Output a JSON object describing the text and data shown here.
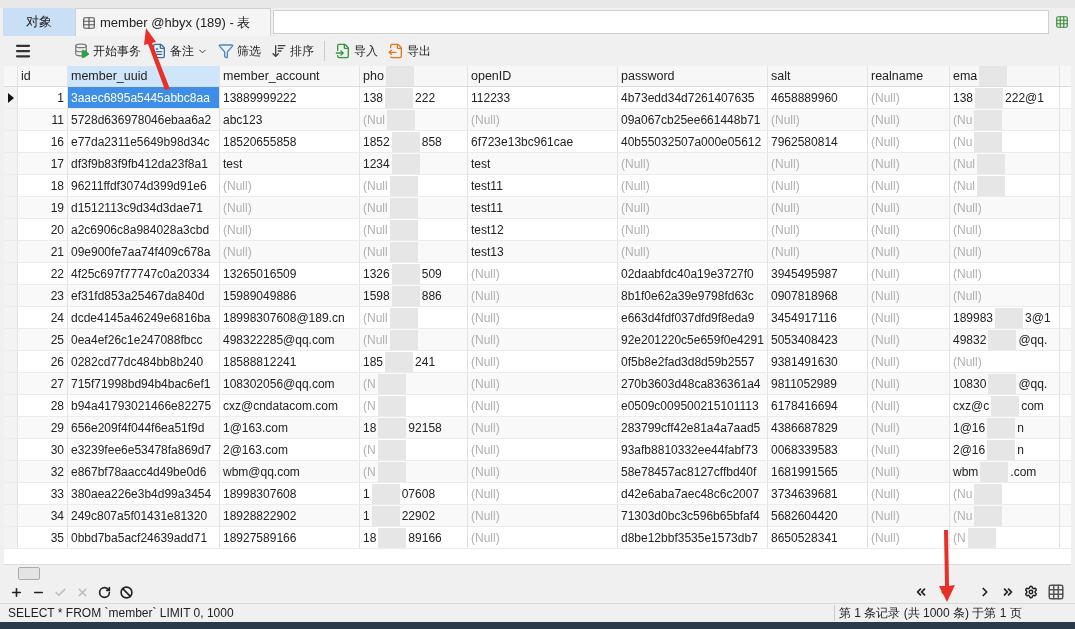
{
  "tabs": [
    {
      "label": "对象",
      "selected": false,
      "kind": "plain"
    },
    {
      "label": "member @hbyx (189) - 表",
      "selected": true,
      "kind": "table"
    }
  ],
  "toolbar": [
    {
      "kind": "begin",
      "label": "开始事务"
    },
    {
      "kind": "note",
      "label": "备注"
    },
    {
      "kind": "filter",
      "label": "筛选"
    },
    {
      "kind": "sort",
      "label": "排序"
    },
    {
      "kind": "import",
      "label": "导入"
    },
    {
      "kind": "export",
      "label": "导出"
    }
  ],
  "table": {
    "columns": [
      {
        "label": "id",
        "focused": false
      },
      {
        "label": "member_uuid",
        "focused": true
      },
      {
        "label": "member_account",
        "focused": false
      },
      {
        "label": "pho",
        "focused": false,
        "redacted": true
      },
      {
        "label": "openID",
        "focused": false
      },
      {
        "label": "password",
        "focused": false
      },
      {
        "label": "salt",
        "focused": false
      },
      {
        "label": "realname",
        "focused": false
      },
      {
        "label": "ema",
        "focused": false,
        "redacted": true
      }
    ],
    "rows": [
      {
        "selected": true,
        "cells": [
          "1",
          "3aaec6895a5445abbc8aa",
          "13889999222",
          {
            "t": "138",
            "t2": "222",
            "redacted": true
          },
          "112233",
          "4b73edd34d7261407635",
          "4658889960",
          {
            "t": "(Null)",
            "null": true
          },
          {
            "t": "138",
            "t2": "222@1",
            "redacted": true
          }
        ]
      },
      {
        "selected": false,
        "cells": [
          "11",
          "5728d636978046ebaa6a2",
          "abc123",
          {
            "t": "(Nul",
            "null": true,
            "redacted": true
          },
          {
            "t": "(Null)",
            "null": true
          },
          "09a067cb25ee661448b71",
          {
            "t": "(Null)",
            "null": true
          },
          {
            "t": "(Null)",
            "null": true
          },
          {
            "t": "(Nu",
            "null": true,
            "redacted": true
          }
        ]
      },
      {
        "selected": false,
        "cells": [
          "16",
          "e77da2311e5649b98d34c",
          "18520655858",
          {
            "t": "1852",
            "t2": "858",
            "redacted": true
          },
          "6f723e13bc961cae",
          "40b55032507a000e05612",
          "7962580814",
          {
            "t": "(Null)",
            "null": true
          },
          {
            "t": "(Nu",
            "null": true,
            "redacted": true
          }
        ]
      },
      {
        "selected": false,
        "cells": [
          "17",
          "df3f9b83f9fb412da23f8a1",
          "test",
          {
            "t": "1234",
            "redacted": true
          },
          "test",
          {
            "t": "(Null)",
            "null": true
          },
          {
            "t": "(Null)",
            "null": true
          },
          {
            "t": "(Null)",
            "null": true
          },
          {
            "t": "(Nul",
            "null": true,
            "redacted": true
          }
        ]
      },
      {
        "selected": false,
        "cells": [
          "18",
          "96211ffdf3074d399d91e6",
          {
            "t": "(Null)",
            "null": true
          },
          {
            "t": "(Null",
            "null": true,
            "redacted": true
          },
          "test11",
          {
            "t": "(Null)",
            "null": true
          },
          {
            "t": "(Null)",
            "null": true
          },
          {
            "t": "(Null)",
            "null": true
          },
          {
            "t": "(Nul",
            "null": true,
            "redacted": true
          }
        ]
      },
      {
        "selected": false,
        "cells": [
          "19",
          "d1512113c9d34d3dae71",
          {
            "t": "(Null)",
            "null": true
          },
          {
            "t": "(Null",
            "null": true,
            "redacted": true
          },
          "test11",
          {
            "t": "(Null)",
            "null": true
          },
          {
            "t": "(Null)",
            "null": true
          },
          {
            "t": "(Null)",
            "null": true
          },
          {
            "t": "(Null)",
            "null": true
          }
        ]
      },
      {
        "selected": false,
        "cells": [
          "20",
          "a2c6906c8a984028a3cbd",
          {
            "t": "(Null)",
            "null": true
          },
          {
            "t": "(Null",
            "null": true,
            "redacted": true
          },
          "test12",
          {
            "t": "(Null)",
            "null": true
          },
          {
            "t": "(Null)",
            "null": true
          },
          {
            "t": "(Null)",
            "null": true
          },
          {
            "t": "(Null)",
            "null": true
          }
        ]
      },
      {
        "selected": false,
        "cells": [
          "21",
          "09e900fe7aa74f409c678a",
          {
            "t": "(Null)",
            "null": true
          },
          {
            "t": "(Null",
            "null": true,
            "redacted": true
          },
          "test13",
          {
            "t": "(Null)",
            "null": true
          },
          {
            "t": "(Null)",
            "null": true
          },
          {
            "t": "(Null)",
            "null": true
          },
          {
            "t": "(Null)",
            "null": true
          }
        ]
      },
      {
        "selected": false,
        "cells": [
          "22",
          "4f25c697f77747c0a20334",
          "13265016509",
          {
            "t": "1326",
            "t2": "509",
            "redacted": true
          },
          {
            "t": "(Null)",
            "null": true
          },
          "02daabfdc40a19e3727f0",
          "3945495987",
          {
            "t": "(Null)",
            "null": true
          },
          {
            "t": "(Null)",
            "null": true
          }
        ]
      },
      {
        "selected": false,
        "cells": [
          "23",
          "ef31fd853a25467da840d",
          "15989049886",
          {
            "t": "1598",
            "t2": "886",
            "redacted": true
          },
          {
            "t": "(Null)",
            "null": true
          },
          "8b1f0e62a39e9798fd63c",
          "0907818968",
          {
            "t": "(Null)",
            "null": true
          },
          {
            "t": "(Null)",
            "null": true
          }
        ]
      },
      {
        "selected": false,
        "cells": [
          "24",
          "dcde4145a46249e6816ba",
          "18998307608@189.cn",
          {
            "t": "(Null",
            "null": true,
            "redacted": true
          },
          {
            "t": "(Null)",
            "null": true
          },
          "e663d4fdf037dfd9f8eda9",
          "3454917116",
          {
            "t": "(Null)",
            "null": true
          },
          {
            "t": "189983",
            "t2": "3@1",
            "redacted": true
          }
        ]
      },
      {
        "selected": false,
        "cells": [
          "25",
          "0ea4ef26c1e247088fbcc",
          "498322285@qq.com",
          {
            "t": "(Null",
            "null": true,
            "redacted": true
          },
          {
            "t": "(Null)",
            "null": true
          },
          "92e201220c5e659f0e4291",
          "5053408423",
          {
            "t": "(Null)",
            "null": true
          },
          {
            "t": "49832",
            "t2": "@qq.",
            "redacted": true
          }
        ]
      },
      {
        "selected": false,
        "cells": [
          "26",
          "0282cd77dc484bb8b240",
          "18588812241",
          {
            "t": "185",
            "t2": "241",
            "redacted": true
          },
          {
            "t": "(Null)",
            "null": true
          },
          "0f5b8e2fad3d8d59b2557",
          "9381491630",
          {
            "t": "(Null)",
            "null": true
          },
          {
            "t": "(Null)",
            "null": true
          }
        ]
      },
      {
        "selected": false,
        "cells": [
          "27",
          "715f71998bd94b4bac6ef1",
          "108302056@qq.com",
          {
            "t": "(N",
            "null": true,
            "redacted": true
          },
          {
            "t": "(Null)",
            "null": true
          },
          "270b3603d48ca836361a4",
          "9811052989",
          {
            "t": "(Null)",
            "null": true
          },
          {
            "t": "10830",
            "t2": "@qq.",
            "redacted": true
          }
        ]
      },
      {
        "selected": false,
        "cells": [
          "28",
          "b94a41793021466e82275",
          "cxz@cndatacom.com",
          {
            "t": "(N",
            "null": true,
            "redacted": true
          },
          {
            "t": "(Null)",
            "null": true
          },
          "e0509c009500215101113",
          "6178416694",
          {
            "t": "(Null)",
            "null": true
          },
          {
            "t": "cxz@c",
            "t2": "com",
            "redacted": true
          }
        ]
      },
      {
        "selected": false,
        "cells": [
          "29",
          "656e209f4f044f6ea51f9d",
          "1@163.com",
          {
            "t": "18",
            "t2": "92158",
            "redacted": true
          },
          {
            "t": "(Null)",
            "null": true
          },
          "283799cff42e81a4a7aad5",
          "4386687829",
          {
            "t": "(Null)",
            "null": true
          },
          {
            "t": "1@16",
            "t2": "n",
            "redacted": true
          }
        ]
      },
      {
        "selected": false,
        "cells": [
          "30",
          "e3239fee6e53478fa869d7",
          "2@163.com",
          {
            "t": "(N",
            "null": true,
            "redacted": true
          },
          {
            "t": "(Null)",
            "null": true
          },
          "93afb8810332ee44fabf73",
          "0068339583",
          {
            "t": "(Null)",
            "null": true
          },
          {
            "t": "2@16",
            "t2": "n",
            "redacted": true
          }
        ]
      },
      {
        "selected": false,
        "cells": [
          "32",
          "e867bf78aacc4d49be0d6",
          "wbm@qq.com",
          {
            "t": "(N",
            "null": true,
            "redacted": true
          },
          {
            "t": "(Null)",
            "null": true
          },
          "58e78457ac8127cffbd40f",
          "1681991565",
          {
            "t": "(Null)",
            "null": true
          },
          {
            "t": "wbm",
            "t2": ".com",
            "redacted": true
          }
        ]
      },
      {
        "selected": false,
        "cells": [
          "33",
          "380aea226e3b4d99a3454",
          "18998307608",
          {
            "t": "1",
            "t2": "07608",
            "redacted": true
          },
          {
            "t": "(Null)",
            "null": true
          },
          "d42e6aba7aec48c6c2007",
          "3734639681",
          {
            "t": "(Null)",
            "null": true
          },
          {
            "t": "(Nu",
            "null": true,
            "redacted": true
          }
        ]
      },
      {
        "selected": false,
        "cells": [
          "34",
          "249c807a5f01431e81320",
          "18928822902",
          {
            "t": "1",
            "t2": "22902",
            "redacted": true
          },
          {
            "t": "(Null)",
            "null": true
          },
          "71303d0bc3c596b65bfaf4",
          "5682604420",
          {
            "t": "(Null)",
            "null": true
          },
          {
            "t": "(Nu",
            "null": true,
            "redacted": true
          }
        ]
      },
      {
        "selected": false,
        "cells": [
          "35",
          "0bbd7ba5acf24639add71",
          "18927589166",
          {
            "t": "18",
            "t2": "89166",
            "redacted": true
          },
          {
            "t": "(Null)",
            "null": true
          },
          "d8be12bbf3535e1573db7",
          "8650528341",
          {
            "t": "(Null)",
            "null": true
          },
          {
            "t": "(N",
            "null": true,
            "redacted": true
          }
        ]
      }
    ]
  },
  "edit_buttons": [
    {
      "kind": "add",
      "disabled": false
    },
    {
      "kind": "delete",
      "disabled": false
    },
    {
      "kind": "apply",
      "disabled": true
    },
    {
      "kind": "cancel",
      "disabled": true
    },
    {
      "kind": "refresh",
      "disabled": false
    },
    {
      "kind": "stop",
      "disabled": false
    }
  ],
  "status_bar": {
    "query": "SELECT * FROM `member` LIMIT 0, 1000",
    "records": "第 1 条记录 (共 1000 条) 于第 1 页"
  }
}
